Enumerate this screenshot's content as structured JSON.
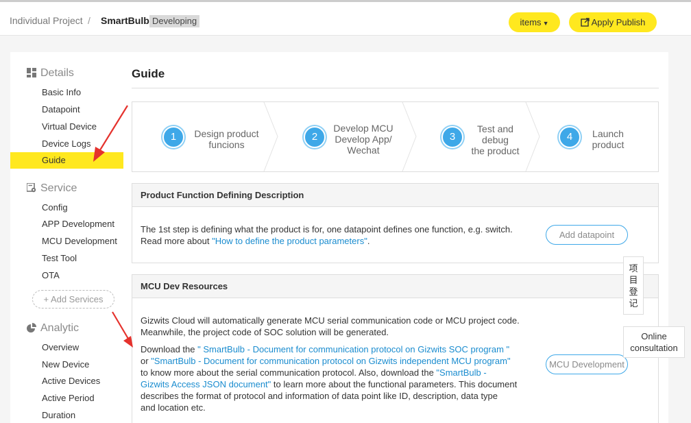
{
  "header": {
    "breadcrumb_parent": "Individual Project",
    "breadcrumb_sep": "/",
    "breadcrumb_current": "SmartBulb",
    "status_badge": "Developing",
    "items_label": "items",
    "publish_label": "Apply Publish",
    "accent": "#ffe81f"
  },
  "sidebar": {
    "details": {
      "title": "Details",
      "items": [
        "Basic Info",
        "Datapoint",
        "Virtual Device",
        "Device Logs",
        "Guide"
      ]
    },
    "service": {
      "title": "Service",
      "items": [
        "Config",
        "APP Development",
        "MCU Development",
        "Test Tool",
        "OTA"
      ],
      "add_label": "+ Add Services"
    },
    "analytic": {
      "title": "Analytic",
      "items": [
        "Overview",
        "New Device",
        "Active Devices",
        "Active Period",
        "Duration"
      ]
    },
    "active_item": "Guide"
  },
  "main": {
    "title": "Guide",
    "steps": [
      {
        "num": "1",
        "line1": "Design product",
        "line2": "funcions",
        "line3": ""
      },
      {
        "num": "2",
        "line1": "Develop MCU",
        "line2": "Develop App/",
        "line3": "Wechat"
      },
      {
        "num": "3",
        "line1": "Test and",
        "line2": "debug",
        "line3": "the product"
      },
      {
        "num": "4",
        "line1": "Launch",
        "line2": "product",
        "line3": ""
      }
    ],
    "product_panel": {
      "title": "Product Function Defining Description",
      "text1": "The 1st step is defining what the product is for, one datapoint defines one function, e.g. switch.",
      "text2_prefix": "Read more about ",
      "text2_link": "\"How to define the product parameters\"",
      "text2_suffix": ".",
      "button": "Add datapoint"
    },
    "mcu_panel": {
      "title": "MCU Dev Resources",
      "para1_line1": "Gizwits Cloud will automatically generate MCU serial communication code or MCU project code.",
      "para1_line2": "Meanwhile, the project code of SOC solution will be generated.",
      "p2_l1_prefix": "Download the ",
      "p2_l1_link": "\" SmartBulb - Document for communication protocol on Gizwits SOC program \"",
      "p2_l2_prefix": "or ",
      "p2_l2_link": "\"SmartBulb - Document for communication protocol on Gizwits independent MCU program\"",
      "p2_l3_prefix": "to know more about the serial communication protocol. Also, download the ",
      "p2_l3_link": "\"SmartBulb -",
      "p2_l4_link": "Gizwits Access JSON document\"",
      "p2_l4_suffix": " to learn more about the functional parameters. This document",
      "p2_l5": "describes the format of protocol and information of data point like ID, description, data type",
      "p2_l6": "and location etc.",
      "button": "MCU Development"
    }
  },
  "floating": {
    "register_chars": [
      "项",
      "目",
      "登",
      "记"
    ],
    "consult_line1": "Online",
    "consult_line2": "consultation"
  },
  "colors": {
    "accent_yellow": "#ffe81f",
    "step_blue": "#3ea8e8",
    "link_blue": "#1a8ccf",
    "annotation_red": "#e5322d"
  }
}
